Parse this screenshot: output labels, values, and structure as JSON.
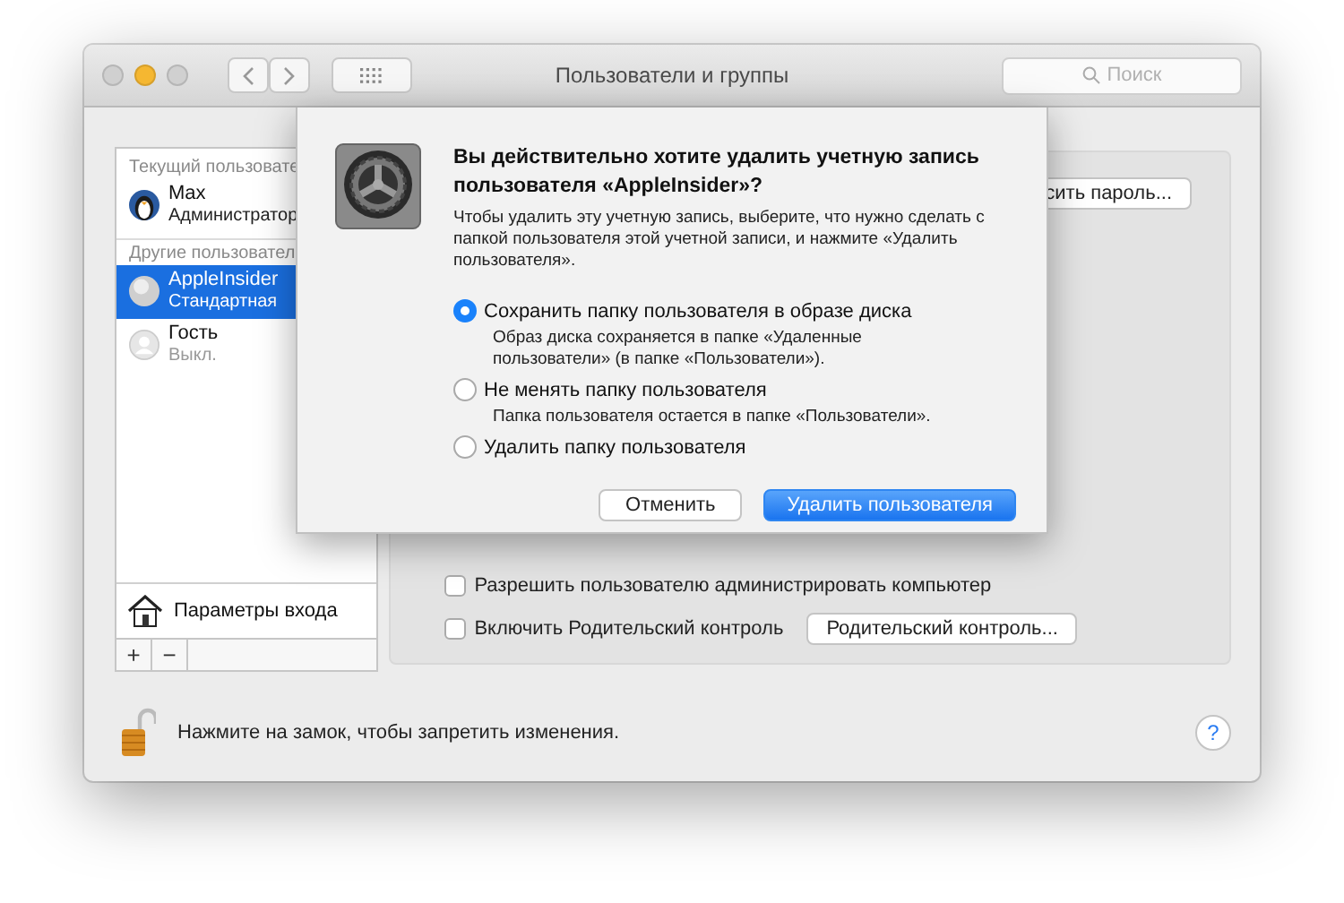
{
  "window": {
    "title": "Пользователи и группы"
  },
  "toolbar": {
    "search": {
      "placeholder": "Поиск"
    }
  },
  "sidebar": {
    "sections": [
      {
        "header": "Текущий пользовате",
        "users": [
          {
            "name": "Max",
            "role": "Администратор",
            "selected": false,
            "kind": "penguin"
          }
        ]
      },
      {
        "header": "Другие пользовател",
        "users": [
          {
            "name": "AppleInsider",
            "role": "Стандартная",
            "selected": true,
            "kind": "ball"
          },
          {
            "name": "Гость",
            "role": "Выкл.",
            "selected": false,
            "kind": "guest"
          }
        ]
      }
    ],
    "login_options": "Параметры входа",
    "add_button": "+",
    "remove_button": "−"
  },
  "panel": {
    "password_button": "сить пароль...",
    "checkboxes": [
      {
        "label": "Разрешить пользователю администрировать компьютер",
        "checked": false
      },
      {
        "label": "Включить Родительский контроль",
        "checked": false
      }
    ],
    "parental_button": "Родительский контроль..."
  },
  "dialog": {
    "title": "Вы действительно хотите удалить учетную запись пользователя «AppleInsider»?",
    "message": "Чтобы удалить эту учетную запись, выберите, что нужно сделать с папкой пользователя этой учетной записи, и нажмите «Удалить пользователя».",
    "options": [
      {
        "label": "Сохранить папку пользователя в образе диска",
        "description": "Образ диска сохраняется в папке «Удаленные пользователи» (в папке «Пользователи»).",
        "selected": true
      },
      {
        "label": "Не менять папку пользователя",
        "description": "Папка пользователя остается в папке «Пользователи».",
        "selected": false
      },
      {
        "label": "Удалить папку пользователя",
        "selected": false
      }
    ],
    "buttons": [
      {
        "label": "Отменить",
        "kind": "normal"
      },
      {
        "label": "Удалить пользователя",
        "kind": "default"
      }
    ]
  },
  "footer": {
    "lock_text": "Нажмите на замок, чтобы запретить изменения.",
    "help": "?"
  }
}
